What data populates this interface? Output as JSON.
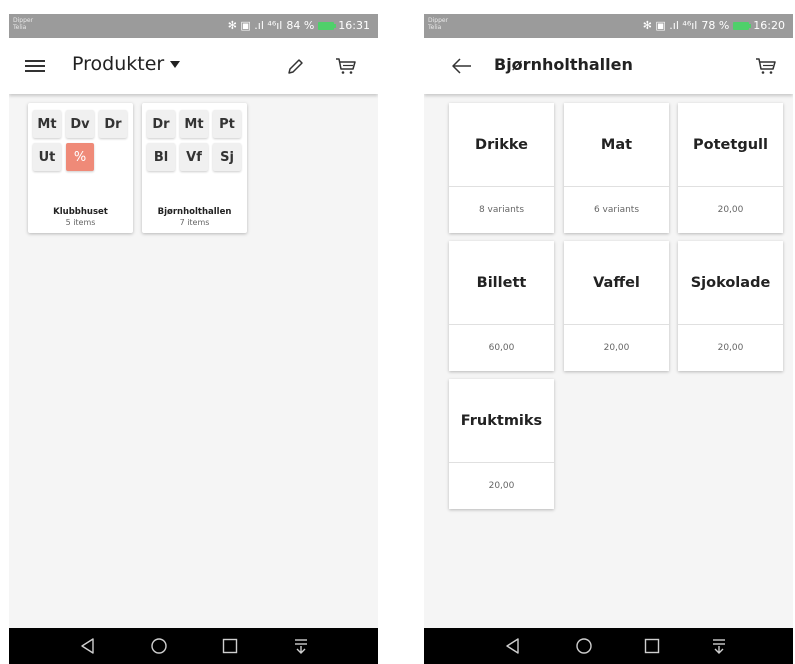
{
  "screens": [
    {
      "carrier": [
        "Dipper",
        "Telia"
      ],
      "status_icons": "✻ ▣  .ıl ⁴⁶ıl",
      "battery_percent": "84 %",
      "time": "16:31",
      "title": "Produkter",
      "categories": [
        {
          "name": "Klubbhuset",
          "count": "5 items",
          "tiles": [
            "Mt",
            "Dv",
            "Dr",
            "Ut",
            "%"
          ]
        },
        {
          "name": "Bjørnholthallen",
          "count": "7 items",
          "tiles": [
            "Dr",
            "Mt",
            "Pt",
            "Bl",
            "Vf",
            "Sj"
          ]
        }
      ]
    },
    {
      "carrier": [
        "Dipper",
        "Telia"
      ],
      "status_icons": "✻ ▣  .ıl ⁴⁶ıl",
      "battery_percent": "78 %",
      "time": "16:20",
      "title": "Bjørnholthallen",
      "products": [
        {
          "name": "Drikke",
          "sub": "8 variants"
        },
        {
          "name": "Mat",
          "sub": "6 variants"
        },
        {
          "name": "Potetgull",
          "sub": "20,00"
        },
        {
          "name": "Billett",
          "sub": "60,00"
        },
        {
          "name": "Vaffel",
          "sub": "20,00"
        },
        {
          "name": "Sjokolade",
          "sub": "20,00"
        },
        {
          "name": "Fruktmiks",
          "sub": "20,00"
        }
      ]
    }
  ],
  "icons": {
    "menu": "hamburger-icon",
    "edit": "pencil-icon",
    "cart": "cart-icon",
    "back": "arrow-left-icon",
    "nav_back": "triangle-back-icon",
    "nav_home": "circle-home-icon",
    "nav_recent": "square-recent-icon",
    "nav_notif": "pull-down-icon"
  },
  "colors": {
    "accent_tile": "#ef8a78",
    "battery": "#4fd06a",
    "status_bar": "#9b9b9b"
  }
}
